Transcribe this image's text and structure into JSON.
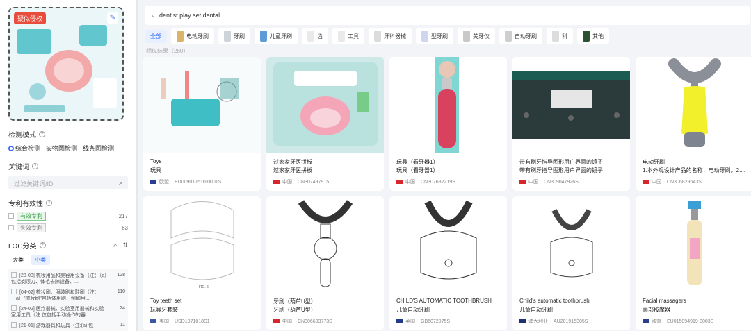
{
  "sidebar": {
    "query_tag": "疑似侵权",
    "detect_mode_label": "检测模式",
    "modes": [
      "综合检测",
      "实物图检测",
      "线条图检测"
    ],
    "keyword_label": "关键词",
    "keyword_placeholder": "过滤关键词/ID",
    "validity_label": "专利有效性",
    "validity": [
      {
        "label": "有效专利",
        "count": "217"
      },
      {
        "label": "失效专利",
        "count": "63"
      }
    ],
    "loc_label": "LOC分类",
    "loc_tabs": [
      "大类",
      "小类"
    ],
    "loc_items": [
      {
        "text": "[28-03] 梳妆用品和美容用设备（注：（a）包括剃须刀、体毛去除设备、...",
        "count": "128"
      },
      {
        "text": "[04-02] 梳妆刷、服装刷和鞋刷（注：（a）\"梳妆刷\"包括体用刷，例如用...",
        "count": "110"
      },
      {
        "text": "[24-02] 医疗器械、实验室用器械和实验室用工具（注:仅包括手动操作的器...",
        "count": "24"
      },
      {
        "text": "[21-01] 游戏器具和玩具（注:(a) 包",
        "count": "11"
      }
    ]
  },
  "search": {
    "query": "dentist play set dental"
  },
  "categories": [
    {
      "label": "全部",
      "active": true
    },
    {
      "label": "电动牙刷",
      "color": "#d9b46a"
    },
    {
      "label": "牙刷",
      "color": "#cfd3da"
    },
    {
      "label": "儿童牙刷",
      "color": "#5f9bd8"
    },
    {
      "label": "齿",
      "color": "#eaeaea"
    },
    {
      "label": "工具",
      "color": "#eaeaea"
    },
    {
      "label": "牙科器械",
      "color": "#dcdcdc"
    },
    {
      "label": "型牙刷",
      "color": "#cfd6ee"
    },
    {
      "label": "美牙仪",
      "color": "#c9c9c9"
    },
    {
      "label": "自动牙刷",
      "color": "#cfcfcf"
    },
    {
      "label": "科",
      "color": "#dcdcdc"
    },
    {
      "label": "其他",
      "color": "#2c5132"
    }
  ],
  "cut_heading": "相似结果（280）",
  "results": [
    {
      "t1": "Toys",
      "t2": "玩具",
      "country": "欧盟",
      "id": "EU009017510-0001S",
      "bg": "#f7fbfb",
      "kind": "toys"
    },
    {
      "t1": "过家家牙医拼板",
      "t2": "过家家牙医拼板",
      "country": "中国",
      "id": "CN307497915",
      "bg": "#cfe9e8",
      "kind": "puzzle"
    },
    {
      "t1": "玩具（看牙器1）",
      "t2": "玩具（看牙器1）",
      "country": "中国",
      "id": "CN307682219S",
      "bg": "#ffffff",
      "kind": "pinkbrush"
    },
    {
      "t1": "带有刷牙指导图形用户界面的镜子",
      "t2": "带有刷牙指导图形用户界面的镜子",
      "country": "中国",
      "id": "CN309047926S",
      "bg": "#ffffff",
      "kind": "screen"
    },
    {
      "t1": "电动牙刷",
      "t2": "1.本外观设计产品的名称：电动牙刷。2....",
      "country": "中国",
      "id": "CN306829643S",
      "bg": "#ffffff",
      "kind": "ubrush"
    },
    {
      "t1": "Toy teeth set",
      "t2": "玩具牙套装",
      "country": "美国",
      "id": "USD1071018S1",
      "bg": "#ffffff",
      "kind": "teeth"
    },
    {
      "t1": "牙刷（葫芦U型）",
      "t2": "牙刷（葫芦U型）",
      "country": "中国",
      "id": "CN306683773S",
      "bg": "#ffffff",
      "kind": "ugourd"
    },
    {
      "t1": "CHILD'S AUTOMATIC TOOTHBRUSH",
      "t2": "儿童自动牙刷",
      "country": "英国",
      "id": "GB6072075S",
      "bg": "#ffffff",
      "kind": "uauto"
    },
    {
      "t1": "Child's automatic toothbrush",
      "t2": "儿童自动牙刷",
      "country": "澳大利亚",
      "id": "AU201915305S",
      "bg": "#ffffff",
      "kind": "uauto2"
    },
    {
      "t1": "Facial massagers",
      "t2": "面部按摩器",
      "country": "欧盟",
      "id": "EU015094919-0003S",
      "bg": "#ffffff",
      "kind": "massager"
    }
  ]
}
